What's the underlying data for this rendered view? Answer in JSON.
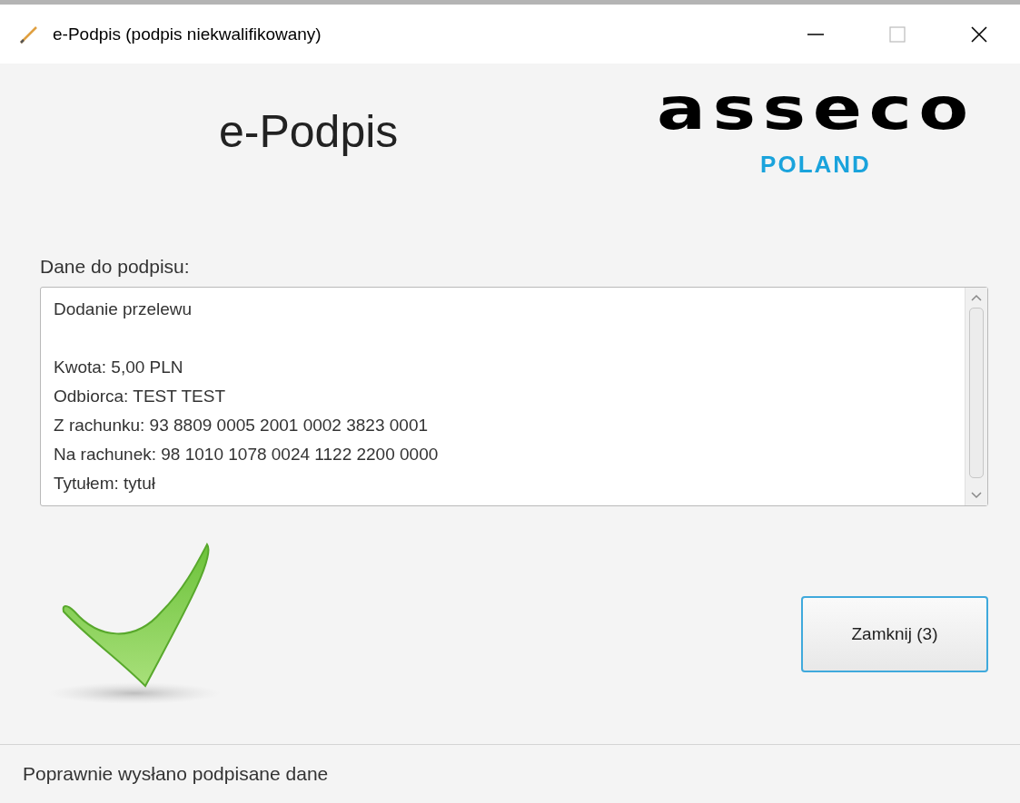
{
  "window": {
    "title": "e-Podpis (podpis niekwalifikowany)"
  },
  "header": {
    "title": "e-Podpis",
    "logo": {
      "wordmark": "asseco",
      "subtitle": "POLAND"
    }
  },
  "data_section": {
    "label": "Dane do podpisu:",
    "heading": "Dodanie przelewu",
    "lines": [
      "Kwota: 5,00 PLN",
      "Odbiorca: TEST TEST",
      "Z rachunku: 93 8809 0005 2001 0002 3823 0001",
      "Na rachunek: 98 1010 1078 0024 1122 2200 0000",
      "Tytułem: tytuł"
    ]
  },
  "result": {
    "kind": "success"
  },
  "close_button": {
    "label": "Zamknij (3)"
  },
  "status_bar": {
    "text": "Poprawnie wysłano podpisane dane"
  }
}
